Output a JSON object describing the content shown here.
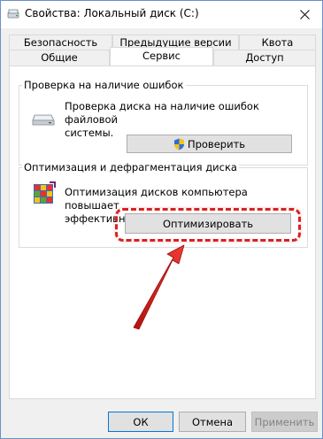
{
  "window": {
    "title": "Свойства: Локальный диск (C:)"
  },
  "tabs": {
    "row1": [
      {
        "label": "Безопасность"
      },
      {
        "label": "Предыдущие версии"
      },
      {
        "label": "Квота"
      }
    ],
    "row2": [
      {
        "label": "Общие"
      },
      {
        "label": "Сервис",
        "active": true
      },
      {
        "label": "Доступ"
      }
    ]
  },
  "error_check": {
    "group_title": "Проверка на наличие ошибок",
    "description_line1": "Проверка диска на наличие ошибок файловой",
    "description_line2": "системы.",
    "button_label": "Проверить"
  },
  "optimize": {
    "group_title": "Оптимизация и дефрагментация диска",
    "description_line1": "Оптимизация дисков компьютера повышает",
    "description_line2": "эффективность его работы.",
    "button_label": "Оптимизировать"
  },
  "footer": {
    "ok_label": "ОК",
    "cancel_label": "Отмена",
    "apply_label": "Применить"
  },
  "icons": {
    "drive": "drive-icon",
    "shield": "uac-shield-icon",
    "defrag": "defrag-icon",
    "close": "close-icon"
  },
  "colors": {
    "annotation": "#d92121",
    "accent": "#0078d7"
  }
}
